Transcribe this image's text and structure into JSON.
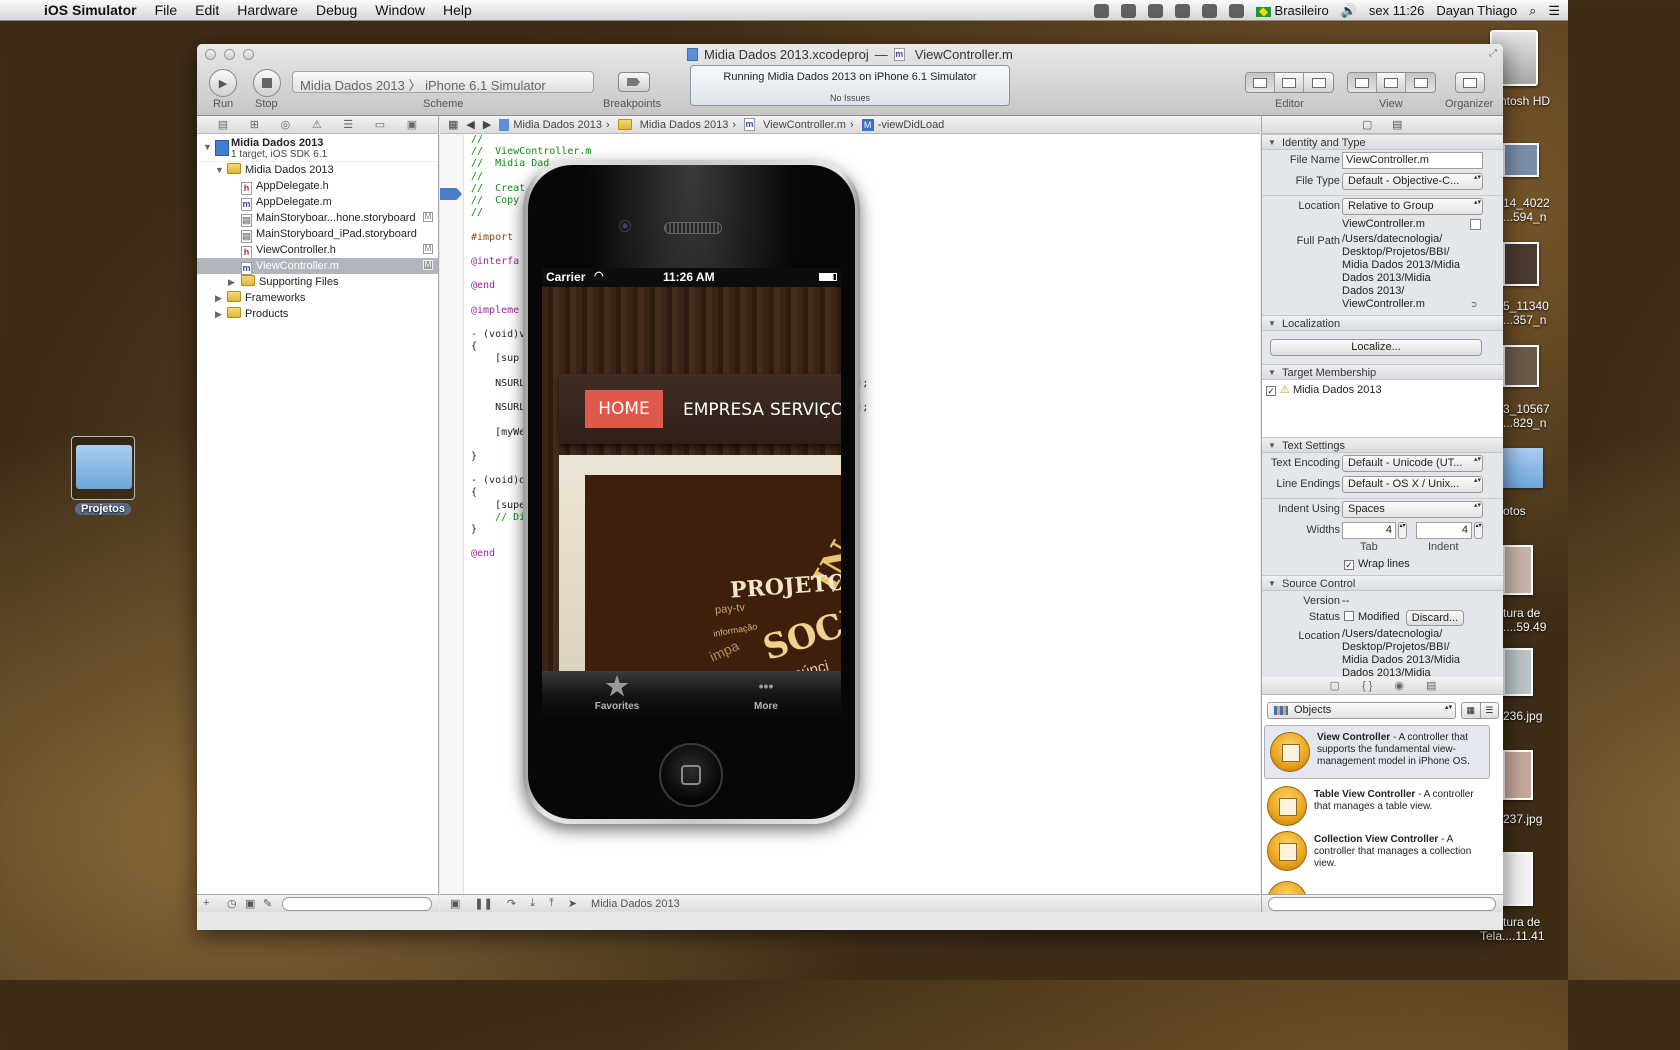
{
  "menubar": {
    "app": "iOS Simulator",
    "items": [
      "File",
      "Edit",
      "Hardware",
      "Debug",
      "Window",
      "Help"
    ],
    "input_source": "Brasileiro",
    "clock": "sex 11:26",
    "user": "Dayan Thiago"
  },
  "desktop": {
    "folder_label": "Projetos",
    "right_labels": [
      "ntosh HD",
      "14_4022",
      "...594_n",
      "5_11340",
      "...357_n",
      "3_10567",
      "...829_n",
      "otos",
      "tura de",
      "....59.49",
      "236.jpg",
      "237.jpg",
      "tura de",
      "Tela....11.41"
    ]
  },
  "window": {
    "title_project": "Midia Dados 2013.xcodeproj",
    "title_sep": "—",
    "title_file": "ViewController.m",
    "toolbar": {
      "run_label": "Run",
      "stop_label": "Stop",
      "scheme_target": "Midia Dados 2013",
      "scheme_sep": "〉",
      "scheme_device": "iPhone 6.1 Simulator",
      "scheme_label": "Scheme",
      "breakpoints_label": "Breakpoints",
      "activity_status": "Running Midia Dados 2013 on iPhone 6.1 Simulator",
      "activity_issues": "No Issues",
      "editor_label": "Editor",
      "view_label": "View",
      "organizer_label": "Organizer"
    }
  },
  "navigator": {
    "project_name": "Midia Dados 2013",
    "project_subtitle": "1 target, iOS SDK 6.1",
    "group": "Midia Dados 2013",
    "files": [
      {
        "name": "AppDelegate.h",
        "kind": "h",
        "badge": ""
      },
      {
        "name": "AppDelegate.m",
        "kind": "m",
        "badge": ""
      },
      {
        "name": "MainStoryboar...hone.storyboard",
        "kind": "s",
        "badge": "M"
      },
      {
        "name": "MainStoryboard_iPad.storyboard",
        "kind": "s",
        "badge": ""
      },
      {
        "name": "ViewController.h",
        "kind": "h",
        "badge": "M"
      },
      {
        "name": "ViewController.m",
        "kind": "m",
        "badge": "M",
        "selected": true
      }
    ],
    "subgroups": [
      "Supporting Files"
    ],
    "top_groups": [
      "Frameworks",
      "Products"
    ]
  },
  "editor": {
    "jump_bar": [
      "Midia Dados 2013",
      "Midia Dados 2013",
      "ViewController.m",
      "-viewDidLoad"
    ],
    "code_lines": [
      {
        "t": "//",
        "c": "cm"
      },
      {
        "t": "//  ViewController.m",
        "c": "cm"
      },
      {
        "t": "//  Midia Dad",
        "c": "cm"
      },
      {
        "t": "//",
        "c": "cm"
      },
      {
        "t": "//  Creat",
        "c": "cm"
      },
      {
        "t": "//  Copy",
        "c": "cm"
      },
      {
        "t": "//",
        "c": "cm"
      },
      {
        "t": "",
        "c": ""
      },
      {
        "t": "#import",
        "c": "pp"
      },
      {
        "t": "",
        "c": ""
      },
      {
        "t": "@interfa",
        "c": "kw"
      },
      {
        "t": "",
        "c": ""
      },
      {
        "t": "@end",
        "c": "kw"
      },
      {
        "t": "",
        "c": ""
      },
      {
        "t": "@impleme",
        "c": "kw"
      },
      {
        "t": "",
        "c": ""
      },
      {
        "t": "- (void)v",
        "c": ""
      },
      {
        "t": "{",
        "c": ""
      },
      {
        "t": "    [sup",
        "c": ""
      },
      {
        "t": "",
        "c": ""
      },
      {
        "t": "    NSURL                                                      \"];",
        "c": ""
      },
      {
        "t": "",
        "c": ""
      },
      {
        "t": "    NSURL                                                      L];",
        "c": ""
      },
      {
        "t": "",
        "c": ""
      },
      {
        "t": "    [myWe",
        "c": ""
      },
      {
        "t": "",
        "c": ""
      },
      {
        "t": "}",
        "c": ""
      },
      {
        "t": "",
        "c": ""
      },
      {
        "t": "- (void)d",
        "c": ""
      },
      {
        "t": "{",
        "c": ""
      },
      {
        "t": "    [supe",
        "c": ""
      },
      {
        "t": "    // Di",
        "c": "cm"
      },
      {
        "t": "}",
        "c": ""
      },
      {
        "t": "",
        "c": ""
      },
      {
        "t": "@end",
        "c": "kw"
      }
    ],
    "debug_target": "Midia Dados 2013"
  },
  "inspector": {
    "identity": {
      "header": "Identity and Type",
      "file_name_label": "File Name",
      "file_name": "ViewController.m",
      "file_type_label": "File Type",
      "file_type": "Default - Objective-C...",
      "location_label": "Location",
      "location": "Relative to Group",
      "location_file": "ViewController.m",
      "full_path_label": "Full Path",
      "full_path_lines": [
        "/Users/datecnologia/",
        "Desktop/Projetos/BBI/",
        "Midia Dados 2013/Midia",
        "Dados 2013/Midia",
        "Dados 2013/",
        "ViewController.m"
      ]
    },
    "localization": {
      "header": "Localization",
      "button": "Localize..."
    },
    "target": {
      "header": "Target Membership",
      "item": "Midia Dados 2013"
    },
    "text_settings": {
      "header": "Text Settings",
      "encoding_label": "Text Encoding",
      "encoding": "Default - Unicode (UT...",
      "endings_label": "Line Endings",
      "endings": "Default - OS X / Unix...",
      "indent_label": "Indent Using",
      "indent": "Spaces",
      "widths_label": "Widths",
      "tab_value": "4",
      "indent_value": "4",
      "tab_label": "Tab",
      "indent_col_label": "Indent",
      "wrap_label": "Wrap lines"
    },
    "source_control": {
      "header": "Source Control",
      "version_label": "Version",
      "version": "--",
      "status_label": "Status",
      "status": "Modified",
      "discard": "Discard...",
      "location_label": "Location",
      "location_lines": [
        "/Users/datecnologia/",
        "Desktop/Projetos/BBI/",
        "Midia Dados 2013/Midia",
        "Dados 2013/Midia"
      ]
    },
    "library": {
      "selector": "Objects",
      "items": [
        {
          "title": "View Controller",
          "desc": " - A controller that supports the fundamental view-management model in iPhone OS."
        },
        {
          "title": "Table View Controller",
          "desc": " - A controller that manages a table view."
        },
        {
          "title": "Collection View Controller",
          "desc": " - A controller that manages a collection view."
        }
      ]
    }
  },
  "simulator": {
    "carrier": "Carrier",
    "time": "11:26 AM",
    "menu": [
      "HOME",
      "EMPRESA",
      "SERVIÇO"
    ],
    "art_words": [
      "PROJETOS",
      "SOCIAL",
      "pay-tv",
      "informação",
      "projetos",
      "IN",
      "impa",
      "anúnci"
    ],
    "tabs": [
      {
        "label": "Favorites",
        "glyph": "★"
      },
      {
        "label": "More",
        "glyph": "•••"
      }
    ]
  }
}
